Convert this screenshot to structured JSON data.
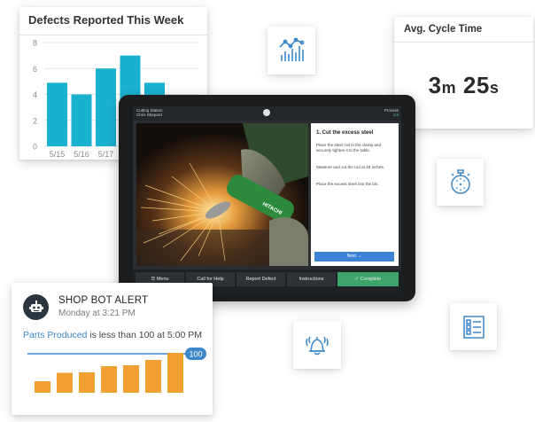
{
  "defects_card": {
    "title": "Defects Reported This Week"
  },
  "chart_data": {
    "type": "bar",
    "title": "Defects Reported This Week",
    "categories": [
      "5/15",
      "5/16",
      "5/17",
      "",
      ""
    ],
    "values": [
      4.9,
      4.0,
      6.0,
      7.0,
      4.9
    ],
    "ylim": [
      0,
      8
    ],
    "yticks": [
      0,
      2,
      4,
      6,
      8
    ],
    "grid": true,
    "bar_color": "#1ab1d1"
  },
  "cycle_card": {
    "title": "Avg. Cycle Time",
    "minutes": "3",
    "minutes_unit": "m",
    "seconds": "25",
    "seconds_unit": "s"
  },
  "tablet": {
    "station_line1": "Cutting Station",
    "station_line2": "Chris Shepard",
    "status_line1": "Process",
    "status_line2": "1:3",
    "step_title": "1.  Cut the excess steel",
    "instructions": [
      "Place the steel rod in the clamp and securely tighten it to the table.",
      "Measure and cut the rod at 48 inches.",
      "Place the excess steel into the bin."
    ],
    "next_label": "Next →",
    "photo_brand": "HITACHI",
    "bottom_buttons": [
      {
        "label": "☰  Menu"
      },
      {
        "label": "Call for Help"
      },
      {
        "label": "Report Defect"
      },
      {
        "label": "Instructions"
      },
      {
        "label": "✓  Complete"
      }
    ]
  },
  "alert_card": {
    "title": "SHOP BOT ALERT",
    "subtitle": "Monday at 3:21 PM",
    "msg_link": "Parts Produced",
    "msg_rest": " is less than 100 at 5:00 PM",
    "threshold_label": "100",
    "bar_values": [
      0.26,
      0.45,
      0.46,
      0.6,
      0.62,
      0.74,
      0.9
    ],
    "bar_color": "#f0a030",
    "threshold_color": "#3b87c8"
  },
  "icons": [
    "analytics-chart-icon",
    "stopwatch-icon",
    "bell-alert-icon",
    "checklist-icon"
  ],
  "colors": {
    "accent_blue": "#3b87c8",
    "chart_cyan": "#1ab1d1",
    "orange": "#f0a030",
    "complete_green": "#3fa46a"
  }
}
